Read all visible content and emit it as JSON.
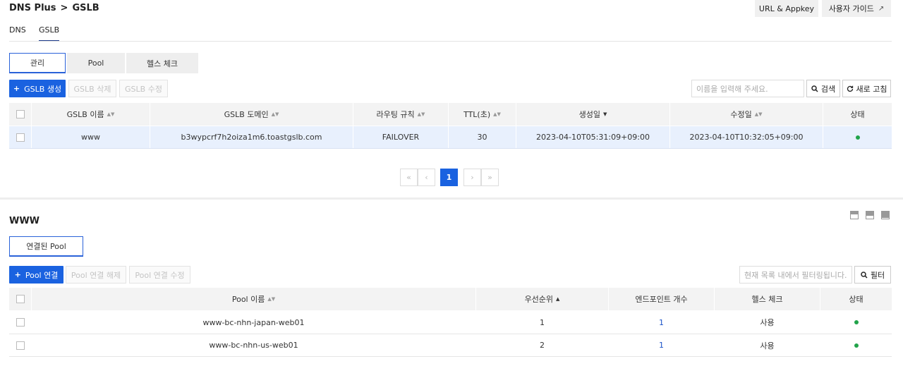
{
  "breadcrumb": {
    "service": "DNS Plus",
    "sep": ">",
    "page": "GSLB"
  },
  "top_buttons": {
    "url_appkey": "URL & Appkey",
    "user_guide": "사용자 가이드",
    "external_icon": "↗"
  },
  "top_tabs": [
    "DNS",
    "GSLB"
  ],
  "sub_tabs": [
    "관리",
    "Pool",
    "헬스 체크"
  ],
  "toolbar": {
    "create": "GSLB 생성",
    "delete": "GSLB 삭제",
    "edit": "GSLB 수정",
    "search_placeholder": "이름을 입력해 주세요.",
    "search": "검색",
    "refresh": "새로 고침"
  },
  "gslb_table": {
    "headers": [
      "GSLB 이름",
      "GSLB 도메인",
      "라우팅 규칙",
      "TTL(초)",
      "생성일",
      "수정일",
      "상태"
    ],
    "rows": [
      {
        "name": "www",
        "domain": "b3wypcrf7h2oiza1m6.toastgslb.com",
        "routing": "FAILOVER",
        "ttl": "30",
        "created": "2023-04-10T05:31:09+09:00",
        "modified": "2023-04-10T10:32:05+09:00"
      }
    ]
  },
  "pagination": {
    "first": "«",
    "prev": "‹",
    "current": "1",
    "next": "›",
    "last": "»"
  },
  "detail": {
    "title": "WWW",
    "tab": "연결된 Pool",
    "toolbar": {
      "connect": "Pool 연결",
      "disconnect": "Pool 연결 해제",
      "edit": "Pool 연결 수정",
      "filter_placeholder": "현재 목록 내에서 필터링됩니다.",
      "filter": "필터"
    },
    "table": {
      "headers": [
        "Pool 이름",
        "우선순위",
        "엔드포인트 개수",
        "헬스 체크",
        "상태"
      ],
      "rows": [
        {
          "name": "www-bc-nhn-japan-web01",
          "priority": "1",
          "endpoints": "1",
          "health": "사용"
        },
        {
          "name": "www-bc-nhn-us-web01",
          "priority": "2",
          "endpoints": "1",
          "health": "사용"
        }
      ]
    }
  },
  "colors": {
    "primary": "#1a62e0",
    "status_ok": "#21a34a",
    "selected_row": "#e8f0fd"
  }
}
